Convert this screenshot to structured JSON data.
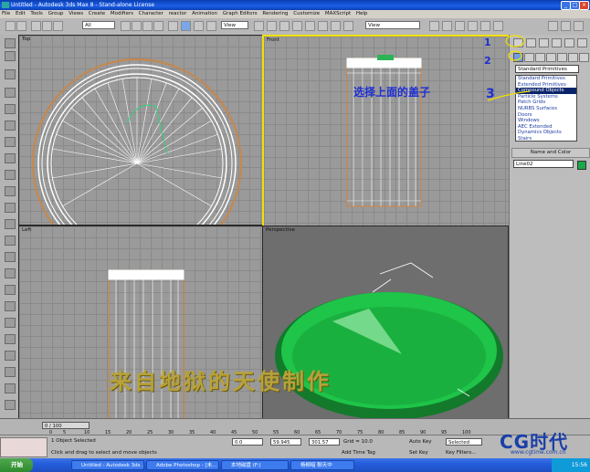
{
  "window": {
    "title": "Untitled - Autodesk 3ds Max 8 - Stand-alone License"
  },
  "menu": [
    "File",
    "Edit",
    "Tools",
    "Group",
    "Views",
    "Create",
    "Modifiers",
    "Character",
    "reactor",
    "Animation",
    "Graph Editors",
    "Rendering",
    "Customize",
    "MAXScript",
    "Help"
  ],
  "toolbar": {
    "selection_filter": "All",
    "ref_coord": "View",
    "ref_coord2": "View"
  },
  "viewports": {
    "top": "Top",
    "front": "Front",
    "left": "Left",
    "perspective": "Perspective"
  },
  "command_panel": {
    "category": "Standard Primitives",
    "list": [
      "Standard Primitives",
      "Extended Primitives",
      "Compound Objects",
      "Particle Systems",
      "Patch Grids",
      "NURBS Surfaces",
      "Doors",
      "Windows",
      "AEC Extended",
      "Dynamics Objects",
      "Stairs"
    ],
    "selected_index": 2,
    "rollout": "Name and Color",
    "object_name": "Line02",
    "object_color": "#1aa84a"
  },
  "annotations": {
    "step1": "1",
    "step2": "2",
    "step3": "3",
    "caption": "选择上面的盖子"
  },
  "watermark": "来自地狱的天使制作",
  "timeline": {
    "frame": "0 / 100",
    "ticks": [
      "0",
      "5",
      "10",
      "15",
      "20",
      "25",
      "30",
      "35",
      "40",
      "45",
      "50",
      "55",
      "60",
      "65",
      "70",
      "75",
      "80",
      "85",
      "90",
      "95",
      "100"
    ]
  },
  "status": {
    "selected": "1 Object Selected",
    "prompt": "Click and drag to select and move objects",
    "x": "0.0",
    "y": "59.945",
    "z": "301.57",
    "grid": "Grid = 10.0",
    "add_time_tag": "Add Time Tag",
    "auto_key": "Auto Key",
    "set_key": "Set Key",
    "selected_dd": "Selected",
    "key_filters": "Key Filters..."
  },
  "taskbar": {
    "start": "开始",
    "tasks": [
      "Untitled - Autodesk 3ds ...",
      "Adobe Photoshop - [未...",
      "本地磁盘 (F:)",
      "杨柳暗 聊天中"
    ],
    "clock": "15:56"
  },
  "logo": {
    "text": "CG时代",
    "url": "www.cgtime.com.cn"
  }
}
